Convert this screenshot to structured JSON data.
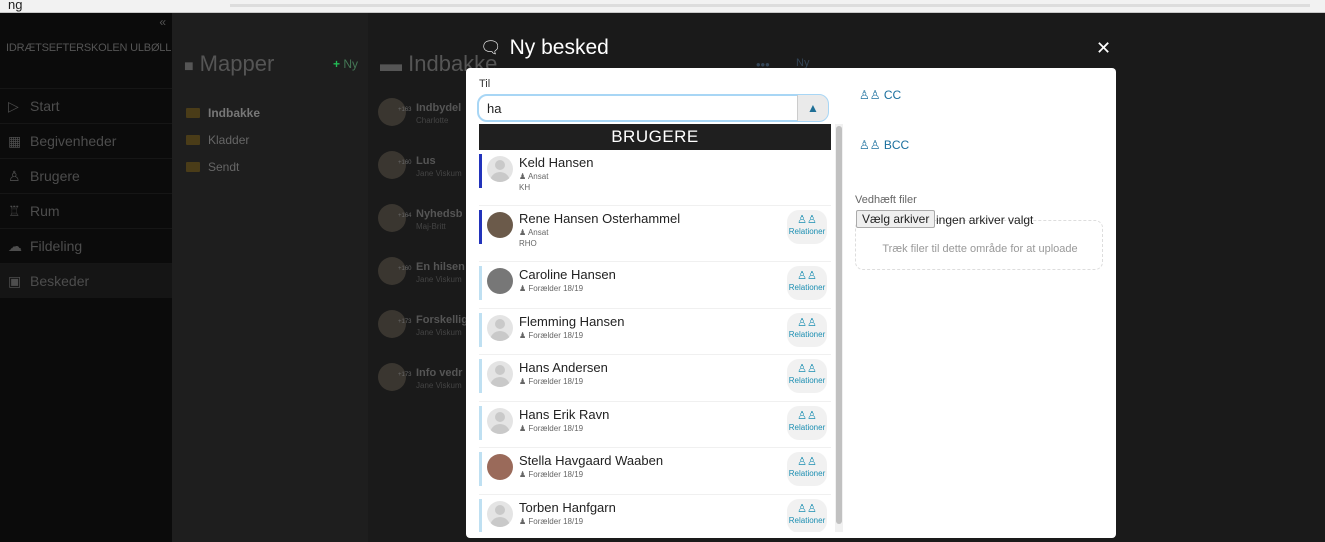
{
  "top": {
    "label": "ng"
  },
  "sidebar": {
    "school": "IDRÆTSEFTERSKOLEN ULBØLLE",
    "items": [
      {
        "label": "Start",
        "icon": "play-icon"
      },
      {
        "label": "Begivenheder",
        "icon": "calendar-icon"
      },
      {
        "label": "Brugere",
        "icon": "users-icon"
      },
      {
        "label": "Rum",
        "icon": "room-icon"
      },
      {
        "label": "Fildeling",
        "icon": "cloud-icon"
      },
      {
        "label": "Beskeder",
        "icon": "chat-icon"
      }
    ]
  },
  "folders": {
    "title": "Mapper",
    "new_label": "Ny",
    "items": [
      "Indbakke",
      "Kladder",
      "Sendt"
    ]
  },
  "inbox": {
    "title": "Indbakke",
    "more": "•••",
    "new_label": "Ny",
    "messages": [
      {
        "count": "+163",
        "title": "Indbydel",
        "sub": "Charlotte"
      },
      {
        "count": "+160",
        "title": "Lus",
        "sub": "Jane Viskum"
      },
      {
        "count": "+164",
        "title": "Nyhedsb",
        "sub": "Maj-Britt"
      },
      {
        "count": "+160",
        "title": "En hilsen",
        "sub": "Jane Viskum"
      },
      {
        "count": "+173",
        "title": "Forskellig",
        "sub": "Jane Viskum"
      },
      {
        "count": "+173",
        "title": "Info vedr",
        "sub": "Jane Viskum"
      }
    ]
  },
  "modal": {
    "title": "Ny besked",
    "close": "✕",
    "to_label": "Til",
    "to_value": "ha",
    "dropdown_header": "BRUGERE",
    "relation_label": "Relationer",
    "cc": "CC",
    "bcc": "BCC",
    "attach_label": "Vedhæft filer",
    "choose_button": "Vælg arkiver",
    "no_file": "ingen arkiver valgt",
    "dropzone": "Træk filer til dette område for at uploade",
    "users": [
      {
        "name": "Keld Hansen",
        "role": "Ansat",
        "initials": "KH",
        "relations": false,
        "stripe": "#2233bb"
      },
      {
        "name": "Rene Hansen Osterhammel",
        "role": "Ansat",
        "initials": "RHO",
        "relations": true,
        "stripe": "#2233bb"
      },
      {
        "name": "Caroline Hansen",
        "role": "Forælder 18/19",
        "initials": "",
        "relations": true,
        "stripe": "#bfe0f2"
      },
      {
        "name": "Flemming Hansen",
        "role": "Forælder 18/19",
        "initials": "",
        "relations": true,
        "stripe": "#bfe0f2"
      },
      {
        "name": "Hans Andersen",
        "role": "Forælder 18/19",
        "initials": "",
        "relations": true,
        "stripe": "#bfe0f2"
      },
      {
        "name": "Hans Erik Ravn",
        "role": "Forælder 18/19",
        "initials": "",
        "relations": true,
        "stripe": "#bfe0f2"
      },
      {
        "name": "Stella Havgaard Waaben",
        "role": "Forælder 18/19",
        "initials": "",
        "relations": true,
        "stripe": "#bfe0f2"
      },
      {
        "name": "Torben Hanfgarn",
        "role": "Forælder 18/19",
        "initials": "",
        "relations": true,
        "stripe": "#bfe0f2"
      }
    ]
  }
}
